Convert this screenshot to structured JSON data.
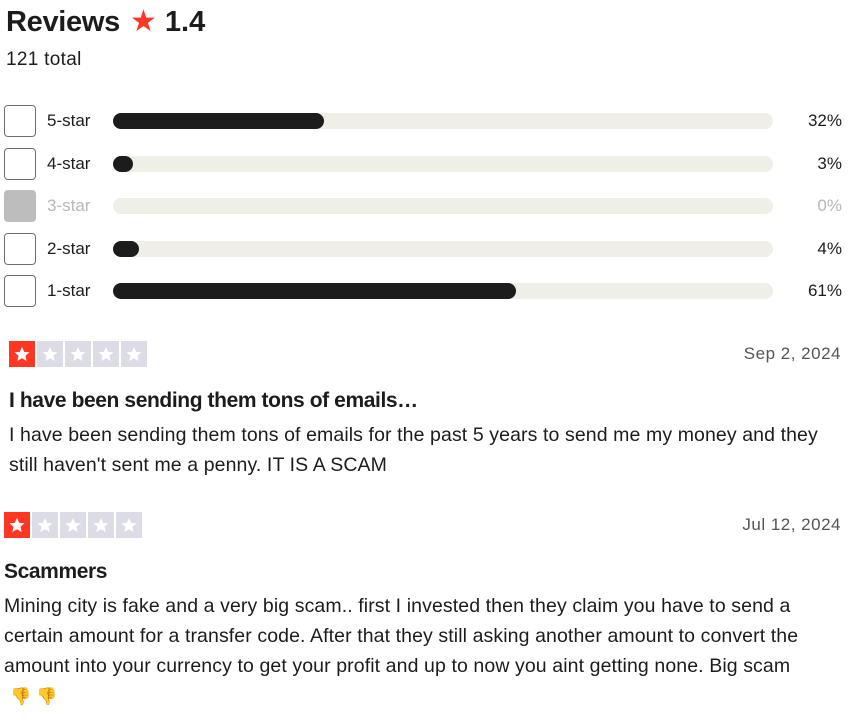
{
  "header": {
    "title": "Reviews",
    "star_icon": "star-icon",
    "rating": "1.4",
    "total": "121 total"
  },
  "distribution": [
    {
      "label": "5-star",
      "percent_label": "32%",
      "percent": 32,
      "disabled": false
    },
    {
      "label": "4-star",
      "percent_label": "3%",
      "percent": 3,
      "disabled": false
    },
    {
      "label": "3-star",
      "percent_label": "0%",
      "percent": 0,
      "disabled": true
    },
    {
      "label": "2-star",
      "percent_label": "4%",
      "percent": 4,
      "disabled": false
    },
    {
      "label": "1-star",
      "percent_label": "61%",
      "percent": 61,
      "disabled": false
    }
  ],
  "reviews": [
    {
      "stars": 1,
      "date": "Sep 2, 2024",
      "title": "I have been sending them tons of emails…",
      "body": "I have been sending them tons of emails for the past 5 years to send me my money and they still haven't sent me a penny. IT IS A SCAM",
      "emoji": ""
    },
    {
      "stars": 1,
      "date": "Jul 12, 2024",
      "title": "Scammers",
      "body": "Mining city is fake and a very big scam.. first I invested then they claim you have to send a certain amount for a transfer code. After that they still asking another amount to convert the amount into your currency to get your profit and up to now you aint getting none. Big scam",
      "emoji": "👎 👎"
    }
  ],
  "colors": {
    "accent_star": "#ff3722",
    "empty_star": "#dcdce6",
    "bar_fill": "#1c1c1c",
    "bar_track": "#efefe7"
  }
}
